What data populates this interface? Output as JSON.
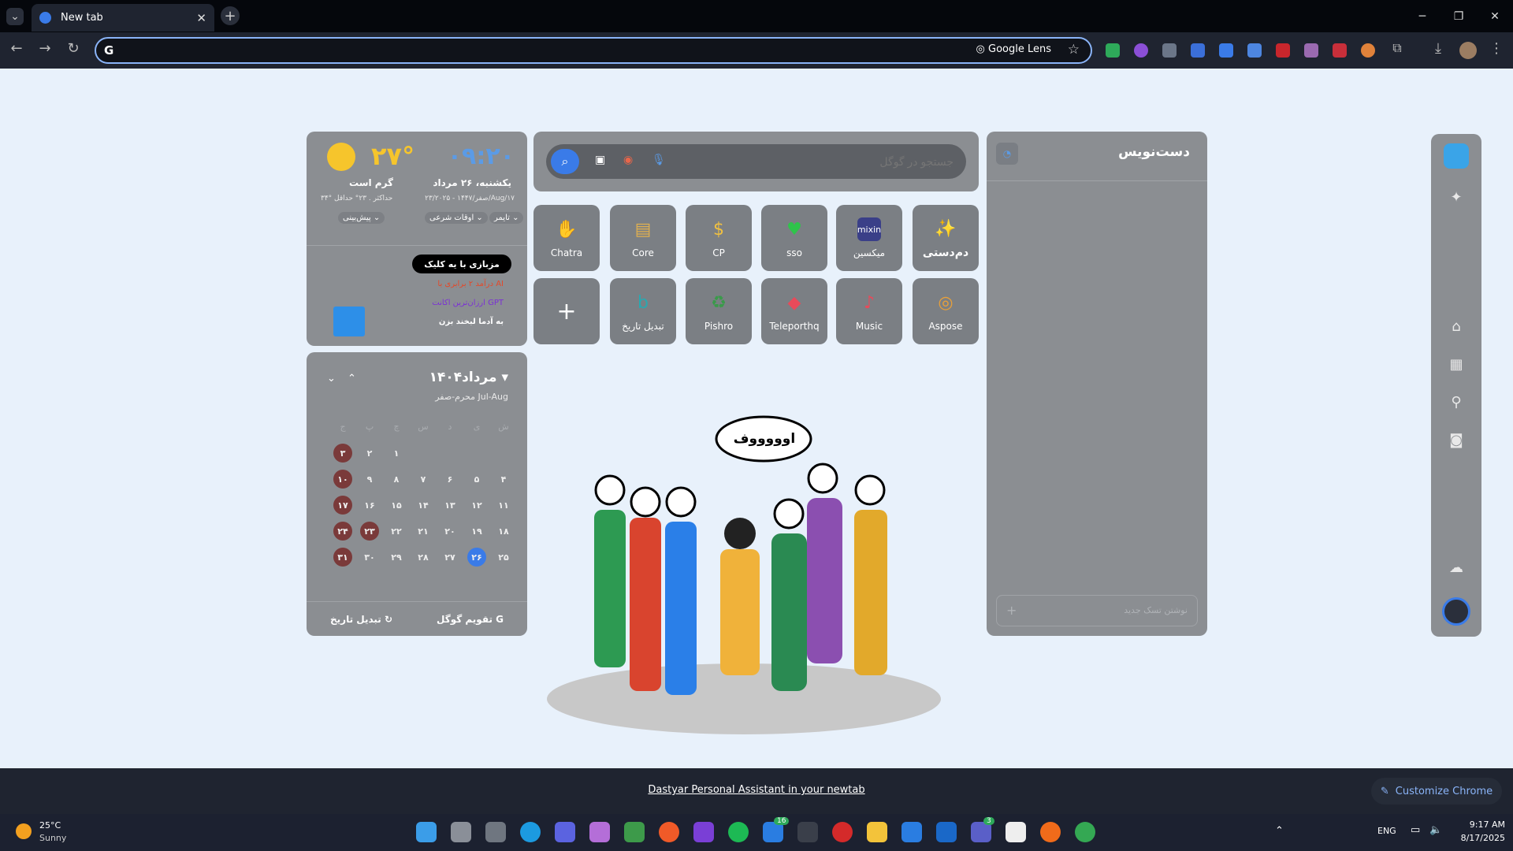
{
  "browser": {
    "tab_title": "New tab",
    "lens_label": "Google Lens",
    "address_value": ""
  },
  "clock": {
    "time": "۰۹:۲۰",
    "date": "یکشنبه، ۲۶ مرداد",
    "date_sub": "۲۳/صفر/۱۴۴۷ - ۲۰۲۵/Aug/۱۷",
    "timer": "تایمر",
    "prayer": "اوقات شرعی"
  },
  "weather": {
    "temp": "۲۷°",
    "desc": "گرم است",
    "range": "۳۴° حداکثر . ۲۳° حداقل",
    "forecast": "پیش‌بینی"
  },
  "promo": {
    "badge": "مزبازی با یه کلیک",
    "item1": "درآمد ۲ برابری با AI",
    "item2": "ارزان‌ترین اکانت GPT",
    "item3": "به آدما لبخند بزن"
  },
  "search": {
    "placeholder": "جستجو در گوگل"
  },
  "shortcuts": [
    {
      "label": "Chatra"
    },
    {
      "label": "Core"
    },
    {
      "label": "CP"
    },
    {
      "label": "sso"
    },
    {
      "label": "میکسین",
      "logo": "mixin"
    },
    {
      "label": "دم‌دستی"
    },
    {
      "label": "تبدیل تاریخ"
    },
    {
      "label": "Pishro"
    },
    {
      "label": "Teleporthq"
    },
    {
      "label": "Music"
    },
    {
      "label": "Aspose"
    }
  ],
  "bubble": "اوووووف",
  "calendar": {
    "month": "مرداد۱۴۰۴",
    "sub_right": "محرم-صفر",
    "sub_left": "Jul-Aug",
    "weekdays": [
      "ش",
      "ی",
      "د",
      "س",
      "چ",
      "پ",
      "ج"
    ],
    "rows": [
      [
        "",
        "",
        "",
        "",
        "۱",
        "۲",
        "۳"
      ],
      [
        "۴",
        "۵",
        "۶",
        "۷",
        "۸",
        "۹",
        "۱۰"
      ],
      [
        "۱۱",
        "۱۲",
        "۱۳",
        "۱۴",
        "۱۵",
        "۱۶",
        "۱۷"
      ],
      [
        "۱۸",
        "۱۹",
        "۲۰",
        "۲۱",
        "۲۲",
        "۲۳",
        "۲۴"
      ],
      [
        "۲۵",
        "۲۶",
        "۲۷",
        "۲۸",
        "۲۹",
        "۳۰",
        "۳۱"
      ]
    ],
    "google": "تقویم گوگل",
    "convert": "تبدیل تاریخ"
  },
  "notes": {
    "title": "دست‌نویس",
    "new_task": "نوشتن تسک جدید"
  },
  "footer": {
    "link": "Dastyar Personal Assistant in your newtab",
    "customize": "Customize Chrome"
  },
  "taskbar": {
    "weather_temp": "25°C",
    "weather_desc": "Sunny",
    "lang": "ENG",
    "time": "9:17 AM",
    "date": "8/17/2025",
    "badge1": "16",
    "badge2": "3"
  }
}
